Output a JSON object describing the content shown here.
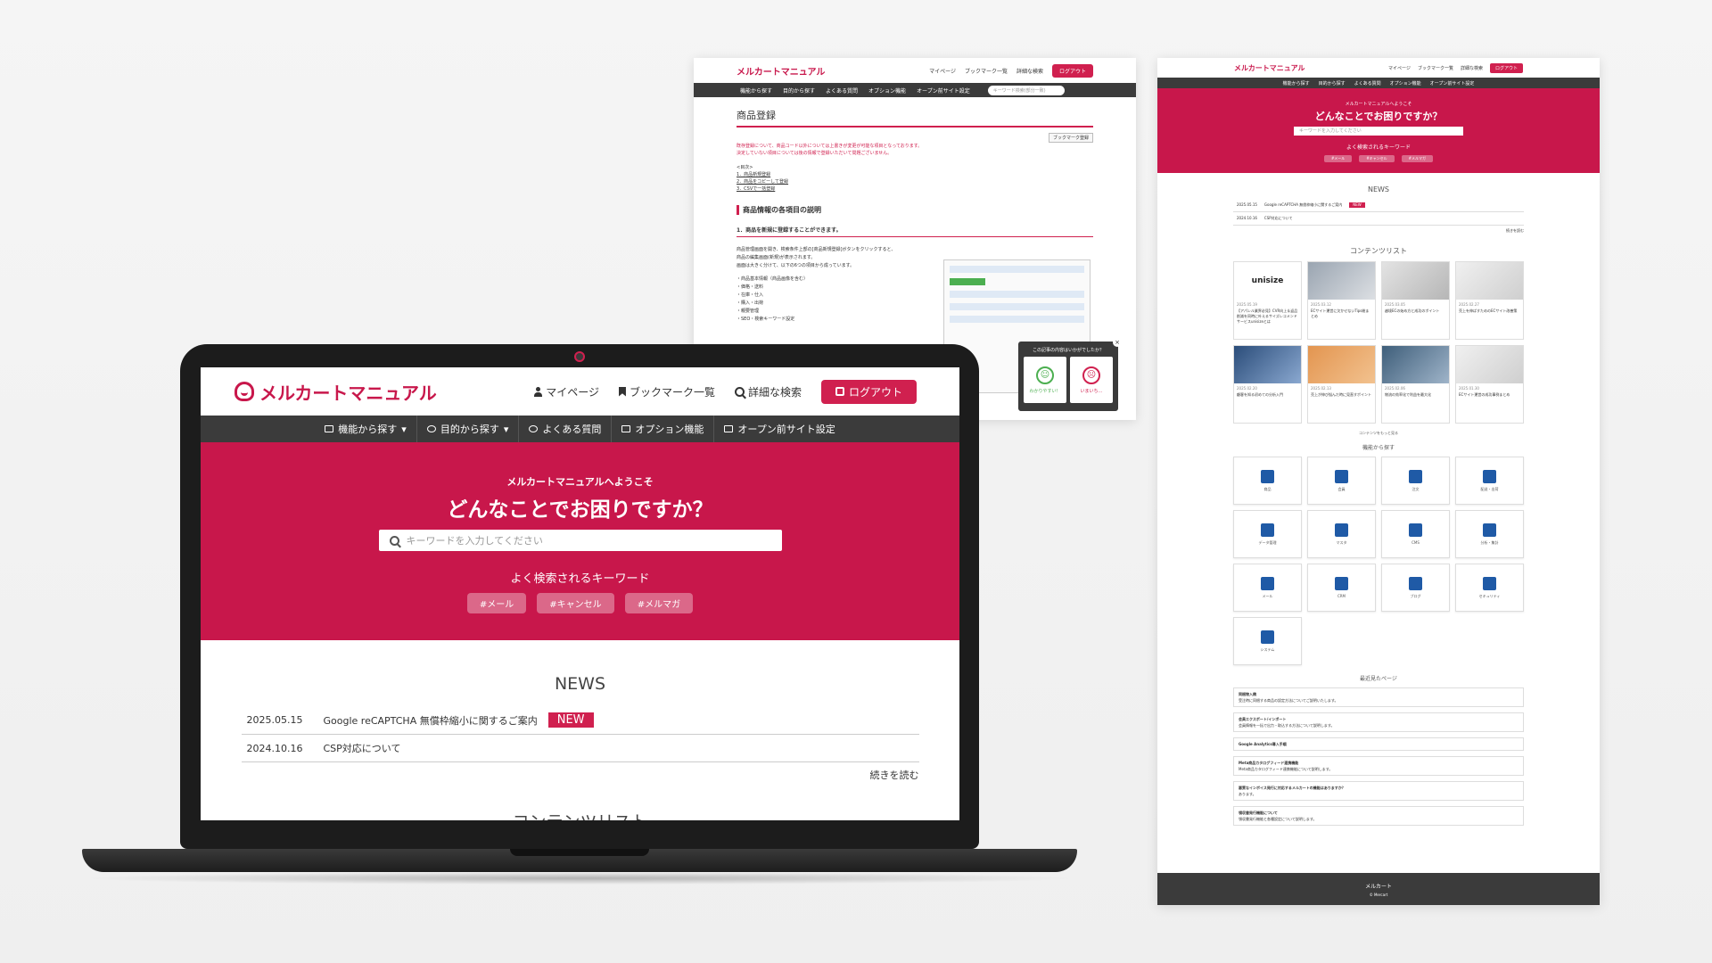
{
  "brand": {
    "name": "メルカートマニュアル",
    "accent": "#c8174b",
    "button_red": "#d0204f",
    "nav_bg": "#3b3b3b"
  },
  "header": {
    "mypage": "マイページ",
    "bookmarks": "ブックマーク一覧",
    "advanced_search": "詳細な検索",
    "logout": "ログアウト"
  },
  "nav": {
    "items": [
      "機能から探す",
      "目的から探す",
      "よくある質問",
      "オプション機能",
      "オープン前サイト設定"
    ]
  },
  "hero": {
    "welcome": "メルカートマニュアルへようこそ",
    "title": "どんなことでお困りですか？",
    "search_placeholder": "キーワードを入力してください",
    "keywords_label": "よく検索されるキーワード",
    "tags": [
      "#メール",
      "#キャンセル",
      "#メルマガ"
    ]
  },
  "news": {
    "title": "NEWS",
    "items": [
      {
        "date": "2025.05.15",
        "text": "Google reCAPTCHA 無償枠縮小に関するご案内",
        "badge": "NEW"
      },
      {
        "date": "2024.10.16",
        "text": "CSP対応について",
        "badge": ""
      }
    ],
    "more": "続きを読む"
  },
  "contents_title": "コンテンツリスト",
  "doc_page": {
    "bookmark_btn": "ブックマーク登録",
    "search_placeholder": "キーワード検索(部分一致)",
    "title": "商品登録",
    "notice": "既存登録について、商品コード以外については上書きが変更が可能な項目となっております。",
    "notice2": "決定していない項目については後の情報で登録いただいて問題ございません。",
    "toc_label": "<目次>",
    "toc": [
      "1．商品新規登録",
      "2．商品をコピーして登録",
      "3．CSVで一括登録"
    ],
    "h2": "商品情報の各項目の説明",
    "h3": "1．商品を新規に登録することができます。",
    "para": [
      "商品管理画面を開き、検索条件上部の[商品新規登録]ボタンをクリックすると、",
      "商品の編集画面(新規)が表示されます。",
      "画面は大きく分けて、以下の6つの項目から成っています。",
      "・商品基本情報（商品画像を含む）",
      "・価格・送料",
      "・在庫・仕入",
      "・購入・出荷",
      "・親要管理",
      "・SEO・検索キーワード設定"
    ],
    "popup_q": "この記事の内容はいかがでしたか？",
    "popup_ok": "わかりやすい！",
    "popup_ng": "いまいち…"
  },
  "full_page": {
    "news": [
      {
        "date": "2025.05.15",
        "text": "Google reCAPTCHA 無償枠縮小に関するご案内",
        "badge": "NEW"
      },
      {
        "date": "2024.10.16",
        "text": "CSP対応について"
      }
    ],
    "more": "続きを読む",
    "cards": [
      {
        "img": "unisize",
        "date": "2025.05.19",
        "title": "【アパレル業界必見】CVR向上＆返品削減を同時に叶えるサイズレコメンドサービスunisizeとは"
      },
      {
        "img": "",
        "date": "2025.03.12",
        "title": "ECサイト運営に欠かせないTips総まとめ"
      },
      {
        "img": "",
        "date": "2025.03.05",
        "title": "越境ECの始め方と成功のポイント"
      },
      {
        "img": "",
        "date": "2025.02.27",
        "title": "売上を伸ばすためのECサイト改善策"
      },
      {
        "img": "",
        "date": "2025.02.20",
        "title": "顧客を知る初めての分析入門"
      },
      {
        "img": "",
        "date": "2025.02.13",
        "title": "売上が伸び悩んだ時に見直すポイント"
      },
      {
        "img": "",
        "date": "2025.02.06",
        "title": "物流の効率化で利益を最大化"
      },
      {
        "img": "",
        "date": "2025.01.30",
        "title": "ECサイト運営の成功事例まとめ"
      }
    ],
    "cards_more": "コンテンツをもっと見る",
    "features_title": "機能から探す",
    "features": [
      "商品",
      "会員",
      "注文",
      "配送・出荷",
      "データ管理",
      "マスタ",
      "CMS",
      "分析・集計",
      "メール",
      "CRM",
      "ブログ",
      "セキュリティ",
      "システム"
    ],
    "recent_title": "最近見たページ",
    "recent": [
      {
        "title": "同梱物入稿",
        "desc": "受注時に同梱する商品の設定方法についてご説明いたします。"
      },
      {
        "title": "会員エクスポート/インポート",
        "desc": "会員情報を一括で出力・取込する方法について説明します。"
      },
      {
        "title": "Google Analytics導入手順",
        "desc": ""
      },
      {
        "title": "Meta商品カタログフィード連携機能",
        "desc": "Meta商品カタログフィード連携機能について説明します。"
      },
      {
        "title": "悪質なインボイス発行に対応するメルカートの機能はありますか？",
        "desc": "あります。"
      },
      {
        "title": "領収書発行機能について",
        "desc": "領収書発行機能と各種設定について説明します。"
      }
    ],
    "footer": "メルカート",
    "footer_sub": "© Mercart"
  }
}
